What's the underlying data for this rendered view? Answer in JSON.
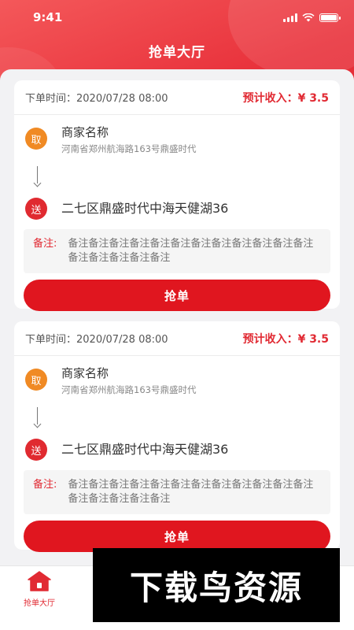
{
  "status_bar": {
    "time": "9:41"
  },
  "page": {
    "title": "抢单大厅"
  },
  "orders": [
    {
      "time_label": "下单时间：",
      "time_value": "2020/07/28 08:00",
      "income_label": "预计收入：",
      "income_value": "¥ 3.5",
      "pickup_badge": "取",
      "merchant_name": "商家名称",
      "merchant_address": "河南省郑州航海路163号鼎盛时代",
      "delivery_badge": "送",
      "delivery_address": "二七区鼎盛时代中海天健湖36",
      "note_label": "备注:",
      "note_text": "备注备注备注备注备注备注备注备注备注备注备注备注备注备注备注备注备注",
      "grab_label": "抢单"
    },
    {
      "time_label": "下单时间：",
      "time_value": "2020/07/28 08:00",
      "income_label": "预计收入：",
      "income_value": "¥ 3.5",
      "pickup_badge": "取",
      "merchant_name": "商家名称",
      "merchant_address": "河南省郑州航海路163号鼎盛时代",
      "delivery_badge": "送",
      "delivery_address": "二七区鼎盛时代中海天健湖36",
      "note_label": "备注:",
      "note_text": "备注备注备注备注备注备注备注备注备注备注备注备注备注备注备注备注备注",
      "grab_label": "抢单"
    }
  ],
  "tab_bar": {
    "items": [
      {
        "label": "抢单大厅",
        "icon": "home-icon",
        "active": true
      }
    ]
  },
  "watermark": {
    "text": "下载鸟资源"
  },
  "colors": {
    "brand_red": "#e12a33",
    "button_red": "#e0161f",
    "pickup_orange": "#f08a24"
  }
}
